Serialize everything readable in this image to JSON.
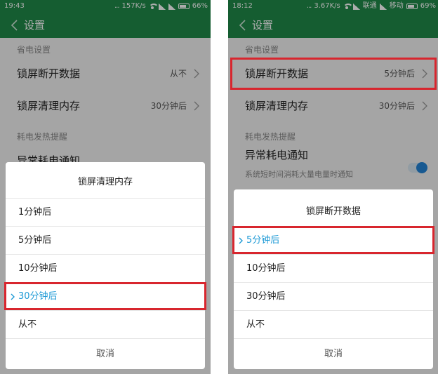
{
  "left": {
    "status": {
      "time": "19:43",
      "dots": "...",
      "speed": "157K/s",
      "battery": "66%",
      "battery_level": 0.66
    },
    "header": {
      "title": "设置"
    },
    "sections": [
      {
        "header": "省电设置"
      },
      {
        "header": "耗电发热提醒"
      }
    ],
    "rows": [
      {
        "label": "锁屏断开数据",
        "value": "从不"
      },
      {
        "label": "锁屏清理内存",
        "value": "30分钟后"
      },
      {
        "label": "异常耗电通知"
      }
    ],
    "dialog": {
      "title": "锁屏清理内存",
      "options": [
        "1分钟后",
        "5分钟后",
        "10分钟后",
        "30分钟后",
        "从不"
      ],
      "selected": "30分钟后",
      "cancel": "取消"
    }
  },
  "right": {
    "status": {
      "time": "18:12",
      "dots": "...",
      "speed": "3.67K/s",
      "carrier1": "联通",
      "carrier2": "移动",
      "battery": "69%",
      "battery_level": 0.69
    },
    "header": {
      "title": "设置"
    },
    "sections": [
      {
        "header": "省电设置"
      },
      {
        "header": "耗电发热提醒"
      }
    ],
    "rows": [
      {
        "label": "锁屏断开数据",
        "value": "5分钟后"
      },
      {
        "label": "锁屏清理内存",
        "value": "30分钟后"
      },
      {
        "label": "异常耗电通知",
        "sub": "系统短时间消耗大量电量时通知",
        "toggle_on": true
      }
    ],
    "dialog": {
      "title": "锁屏断开数据",
      "options": [
        "5分钟后",
        "10分钟后",
        "30分钟后",
        "从不"
      ],
      "selected": "5分钟后",
      "cancel": "取消"
    }
  },
  "colors": {
    "header_green": "#1f8a49",
    "accent_blue": "#1e9ad6",
    "highlight_red": "#d8262e"
  }
}
